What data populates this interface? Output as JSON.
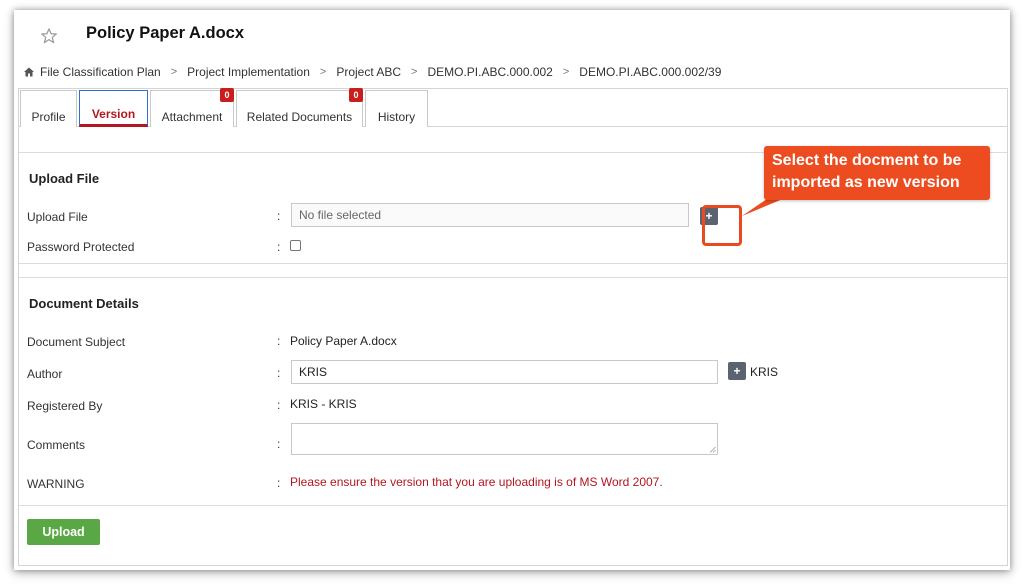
{
  "header": {
    "title": "Policy Paper A.docx",
    "star_icon": "star-outline-icon"
  },
  "breadcrumb": {
    "home_icon": "home-icon",
    "items": [
      "File Classification Plan",
      "Project Implementation",
      "Project ABC",
      "DEMO.PI.ABC.000.002",
      "DEMO.PI.ABC.000.002/39"
    ],
    "separator": ">"
  },
  "tabs": [
    {
      "label": "Profile",
      "active": false
    },
    {
      "label": "Version",
      "active": true
    },
    {
      "label": "Attachment",
      "active": false,
      "badge": "0"
    },
    {
      "label": "Related Documents",
      "active": false,
      "badge": "0"
    },
    {
      "label": "History",
      "active": false
    }
  ],
  "upload_section": {
    "title": "Upload File",
    "upload_label": "Upload File",
    "file_placeholder": "No file selected",
    "add_button_label": "+",
    "password_label": "Password Protected",
    "password_checked": false
  },
  "details_section": {
    "title": "Document Details",
    "subject_label": "Document Subject",
    "subject_value": "Policy Paper A.docx",
    "author_label": "Author",
    "author_value": "KRIS",
    "author_add_label": "+",
    "author_name": "KRIS",
    "registered_label": "Registered By",
    "registered_value": "KRIS - KRIS",
    "comments_label": "Comments",
    "comments_value": "",
    "warning_label": "WARNING",
    "warning_text": "Please ensure the version that you are uploading is of MS Word 2007."
  },
  "colon": ":",
  "actions": {
    "upload_label": "Upload"
  },
  "callout": {
    "line1": "Select the docment to be",
    "line2": "imported as new version"
  },
  "colors": {
    "accent_red": "#b3171f",
    "callout_orange": "#ec4c1f",
    "upload_green": "#5aa745",
    "badge_red": "#c81e1e"
  }
}
